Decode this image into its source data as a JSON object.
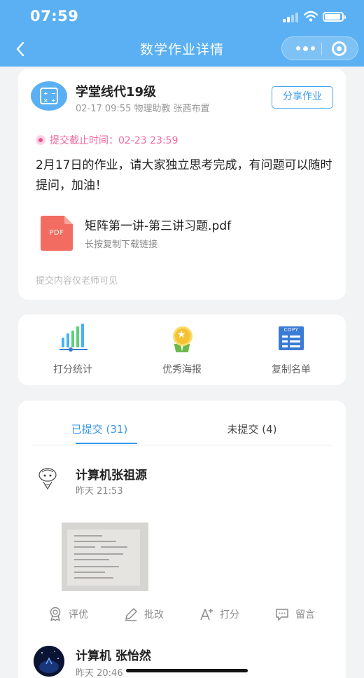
{
  "status_bar": {
    "time": "07:59"
  },
  "nav": {
    "title": "数学作业详情"
  },
  "homework": {
    "class_name": "学堂线代19级",
    "meta": "02-17 09:55 物理助教 张茜布置",
    "share_label": "分享作业",
    "deadline": "提交截止时间：02-23 23:59",
    "description": "2月17日的作业，请大家独立思考完成，有问题可以随时提问，加油！",
    "attachment": {
      "icon_label": "PDF",
      "file_name": "矩阵第一讲-第三讲习题.pdf",
      "hint": "长按复制下载链接"
    },
    "visibility_note": "提交内容仅老师可见"
  },
  "actions": [
    {
      "label": "打分统计",
      "icon": "bar-chart-icon"
    },
    {
      "label": "优秀海报",
      "icon": "medal-icon"
    },
    {
      "label": "复制名单",
      "icon": "copy-list-icon",
      "icon_text": "COPY"
    }
  ],
  "tabs": [
    {
      "label": "已提交 (31)",
      "active": true
    },
    {
      "label": "未提交 (4)",
      "active": false
    }
  ],
  "submissions": [
    {
      "name": "计算机张祖源",
      "time": "昨天 21:53",
      "operations": [
        "评优",
        "批改",
        "打分",
        "留言"
      ]
    },
    {
      "name": "计算机 张怡然",
      "time": "昨天 20:46"
    }
  ],
  "colors": {
    "header": "#5ab0f2",
    "accent": "#3a98e8",
    "deadline": "#ee6aa0",
    "pdf": "#f26c61"
  }
}
